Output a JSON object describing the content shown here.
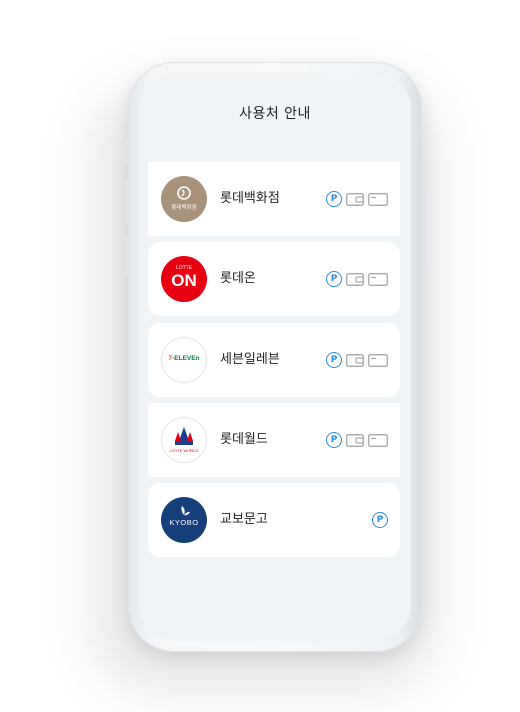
{
  "page": {
    "title": "사용처 안내"
  },
  "stores": [
    {
      "name": "롯데백화점",
      "logo_text": "롯데백화점",
      "icons": [
        "point-icon",
        "wallet-icon",
        "card-icon"
      ]
    },
    {
      "name": "롯데온",
      "logo_text_top": "LOTTE",
      "logo_text_main": "ON",
      "icons": [
        "point-icon",
        "wallet-icon",
        "card-icon"
      ]
    },
    {
      "name": "세븐일레븐",
      "logo_text_prefix": "7-",
      "logo_text": "ELEVEn",
      "icons": [
        "point-icon",
        "wallet-icon",
        "card-icon"
      ]
    },
    {
      "name": "롯데월드",
      "logo_text": "LOTTE WORLD",
      "icons": [
        "point-icon",
        "wallet-icon",
        "card-icon"
      ]
    },
    {
      "name": "교보문고",
      "logo_text": "KYOBO",
      "icons": [
        "point-icon"
      ]
    }
  ],
  "icon_labels": {
    "point": "P"
  },
  "colors": {
    "point_blue": "#2a8fd8",
    "lotte_red": "#e60012",
    "kyobo_navy": "#153e7a",
    "dept_brown": "#a9927a",
    "seven_green": "#00843d",
    "seven_red": "#e8401c"
  }
}
